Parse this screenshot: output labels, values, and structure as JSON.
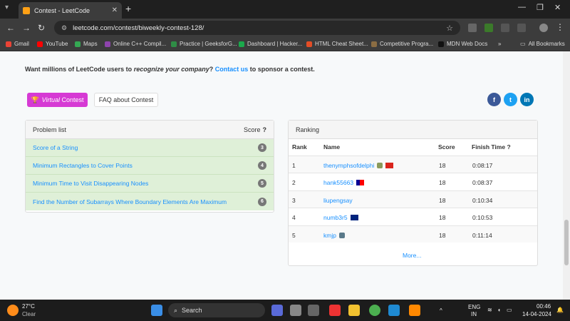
{
  "browser": {
    "tab_title": "Contest - LeetCode",
    "url": "leetcode.com/contest/biweekly-contest-128/",
    "bookmarks": [
      {
        "label": "Gmail",
        "color": "#ea4335"
      },
      {
        "label": "YouTube",
        "color": "#ff0000"
      },
      {
        "label": "Maps",
        "color": "#34a853"
      },
      {
        "label": "Online C++ Compil...",
        "color": "#8e44ad"
      },
      {
        "label": "Practice | GeeksforG...",
        "color": "#2f8d46"
      },
      {
        "label": "Dashboard | Hacker...",
        "color": "#1ba94c"
      },
      {
        "label": "HTML Cheat Sheet...",
        "color": "#e44d26"
      },
      {
        "label": "Competitive Progra...",
        "color": "#8b6d43"
      },
      {
        "label": "MDN Web Docs",
        "color": "#111111"
      }
    ],
    "all_bookmarks": "All Bookmarks"
  },
  "page": {
    "sponsor_prefix": "Want millions of LeetCode users to ",
    "sponsor_em": "recognize your company",
    "sponsor_mid": "? ",
    "sponsor_link": "Contact us",
    "sponsor_suffix": " to sponsor a contest.",
    "virtual_em": "Virtual",
    "virtual_rest": "Contest",
    "faq": "FAQ about Contest",
    "social": [
      {
        "label": "f",
        "color": "#3b5998"
      },
      {
        "label": "t",
        "color": "#1da1f2"
      },
      {
        "label": "in",
        "color": "#0077b5"
      }
    ]
  },
  "problems": {
    "header": "Problem list",
    "score_header": "Score",
    "items": [
      {
        "title": "Score of a String",
        "score": "3"
      },
      {
        "title": "Minimum Rectangles to Cover Points",
        "score": "4"
      },
      {
        "title": "Minimum Time to Visit Disappearing Nodes",
        "score": "5"
      },
      {
        "title": "Find the Number of Subarrays Where Boundary Elements Are Maximum",
        "score": "6"
      }
    ]
  },
  "ranking": {
    "header": "Ranking",
    "columns": [
      "Rank",
      "Name",
      "Score",
      "Finish Time"
    ],
    "rows": [
      {
        "rank": "1",
        "name": "thenymphsofdelphi",
        "score": "18",
        "time": "0:08:17",
        "flag": "vietnam"
      },
      {
        "rank": "2",
        "name": "hank55663",
        "score": "18",
        "time": "0:08:37",
        "flag": "taiwan"
      },
      {
        "rank": "3",
        "name": "liupengsay",
        "score": "18",
        "time": "0:10:34",
        "flag": ""
      },
      {
        "rank": "4",
        "name": "numb3r5",
        "score": "18",
        "time": "0:10:53",
        "flag": "australia"
      },
      {
        "rank": "5",
        "name": "kmjp",
        "score": "18",
        "time": "0:11:14",
        "flag": ""
      }
    ],
    "more": "More..."
  },
  "taskbar": {
    "temp": "27°C",
    "weather": "Clear",
    "search": "Search",
    "lang1": "ENG",
    "lang2": "IN",
    "time": "00:46",
    "date": "14-04-2024"
  }
}
